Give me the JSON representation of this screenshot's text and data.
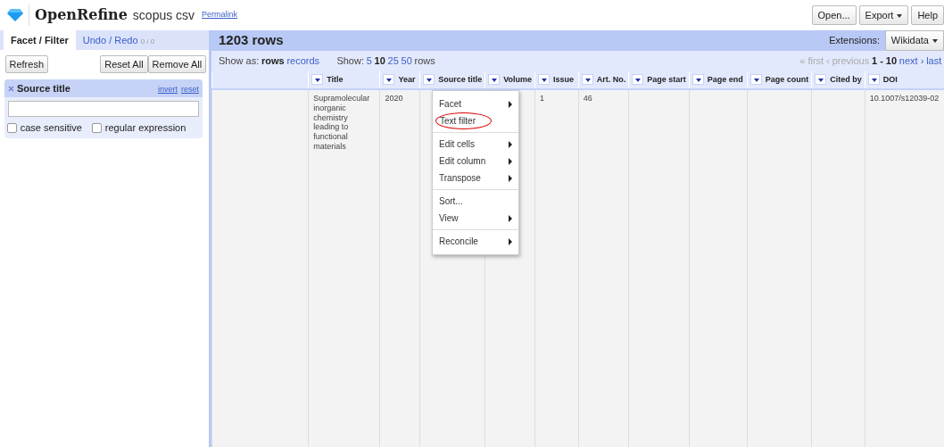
{
  "header": {
    "logo": "OpenRefine",
    "project": "scopus csv",
    "permalink": "Permalink",
    "buttons": [
      {
        "label": "Open...",
        "caret": false
      },
      {
        "label": "Export",
        "caret": true
      },
      {
        "label": "Help",
        "caret": false
      }
    ]
  },
  "left_panel": {
    "tabs": [
      {
        "label": "Facet / Filter",
        "selected": true
      },
      {
        "label": "Undo / Redo",
        "count": "0 / 0",
        "selected": false
      }
    ],
    "refresh": "Refresh",
    "reset_all": "Reset All",
    "remove_all": "Remove All",
    "facet": {
      "title": "Source title",
      "links": [
        "invert",
        "reset"
      ],
      "options": [
        {
          "label": "case sensitive",
          "checked": false
        },
        {
          "label": "regular expression",
          "checked": false
        }
      ]
    }
  },
  "main": {
    "row_count": "1203 rows",
    "extensions_label": "Extensions:",
    "extensions_button": "Wikidata",
    "show_as": {
      "label": "Show as:",
      "modes": [
        {
          "label": "rows",
          "selected": true
        },
        {
          "label": "records",
          "selected": false
        }
      ]
    },
    "page_size": {
      "label": "Show:",
      "options": [
        {
          "label": "5",
          "selected": false
        },
        {
          "label": "10",
          "selected": true
        },
        {
          "label": "25",
          "selected": false
        },
        {
          "label": "50",
          "selected": false
        }
      ],
      "suffix": "rows"
    },
    "pager": {
      "first": "« first",
      "previous": "‹ previous",
      "range": "1 - 10",
      "next": "next ›",
      "last": "last"
    },
    "columns": [
      "Title",
      "Year",
      "Source title",
      "Volume",
      "Issue",
      "Art. No.",
      "Page start",
      "Page end",
      "Page count",
      "Cited by",
      "DOI"
    ],
    "rows": [
      {
        "cells": [
          "Supramolecular inorganic chemistry leading to functional materials",
          "2020",
          "",
          "",
          "1",
          "46",
          "",
          "",
          "",
          "",
          "10.1007/s12039-02"
        ]
      }
    ],
    "column_menu": {
      "groups": [
        [
          {
            "label": "Facet",
            "submenu": true,
            "highlighted": false
          },
          {
            "label": "Text filter",
            "submenu": false,
            "highlighted": true
          }
        ],
        [
          {
            "label": "Edit cells",
            "submenu": true,
            "highlighted": false
          },
          {
            "label": "Edit column",
            "submenu": true,
            "highlighted": false
          },
          {
            "label": "Transpose",
            "submenu": true,
            "highlighted": false
          }
        ],
        [
          {
            "label": "Sort...",
            "submenu": false,
            "highlighted": false
          },
          {
            "label": "View",
            "submenu": true,
            "highlighted": false
          }
        ],
        [
          {
            "label": "Reconcile",
            "submenu": true,
            "highlighted": false
          }
        ]
      ]
    }
  }
}
